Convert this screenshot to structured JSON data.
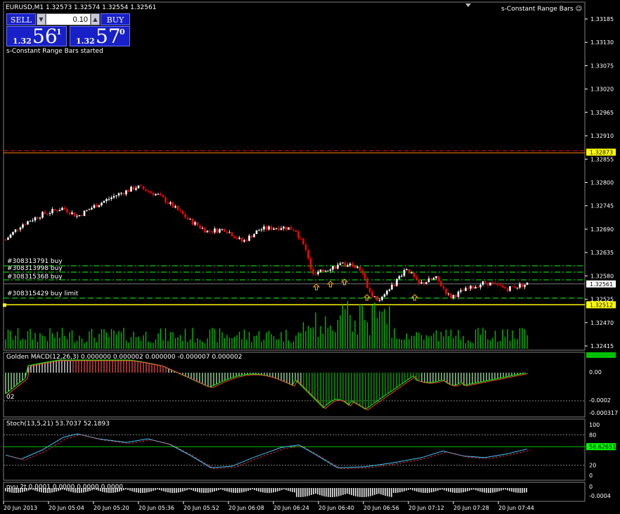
{
  "header": {
    "title": "EURUSD,M1  1.32573 1.32574 1.32554 1.32561",
    "expert": "s-Constant Range Bars",
    "status": "s-Constant Range Bars started"
  },
  "trade_panel": {
    "sell_label": "SELL",
    "buy_label": "BUY",
    "lot": "0.10",
    "bid": {
      "lead": "1.32",
      "main": "56",
      "sup": "1"
    },
    "ask": {
      "lead": "1.32",
      "main": "57",
      "sup": "0"
    }
  },
  "price_axis": [
    "1.33185",
    "1.33130",
    "1.33075",
    "1.33020",
    "1.32965",
    "1.32910",
    "1.32855",
    "1.32800",
    "1.32745",
    "1.32690",
    "1.32635",
    "1.32580",
    "1.32525",
    "1.32470",
    "1.32415"
  ],
  "price_tags": {
    "red_line": "1.32873",
    "current": "1.32561",
    "yellow_line": "1.32512"
  },
  "orders": [
    "#308313791 buy",
    "#308313998 buy",
    "#308315368 buy",
    "#308315429 buy limit"
  ],
  "macd": {
    "label": "Golden MACD(12,26,3) 0.000000 0.000002 0.000000 -0.000007 0.000002",
    "axis": [
      "0.00",
      "-0.0002",
      "-0.000317"
    ],
    "sub_label": "02"
  },
  "stoch": {
    "label": "Stoch(13,5,21) 53.7037 52.1893",
    "axis": [
      "100",
      "80",
      "20",
      "0"
    ],
    "tag": "56.62651"
  },
  "osc": {
    "label": "ovu 2t 0.0001 0.0000 0.0000 0.0000",
    "axis": [
      "0",
      "-0.0004"
    ]
  },
  "time_axis": [
    "20 Jun 2013",
    "20 Jun 05:04",
    "20 Jun 05:20",
    "20 Jun 05:36",
    "20 Jun 05:52",
    "20 Jun 06:08",
    "20 Jun 06:24",
    "20 Jun 06:40",
    "20 Jun 06:56",
    "20 Jun 07:12",
    "20 Jun 07:28",
    "20 Jun 07:44"
  ],
  "colors": {
    "bull": "#ffffff",
    "bear": "#ff0000",
    "grid": "#ffffff",
    "volume": "#00c000",
    "level": "#00ff00",
    "red_level": "#ff0000",
    "yellow": "#ffff00",
    "panel_blue": "#1820c8"
  }
}
